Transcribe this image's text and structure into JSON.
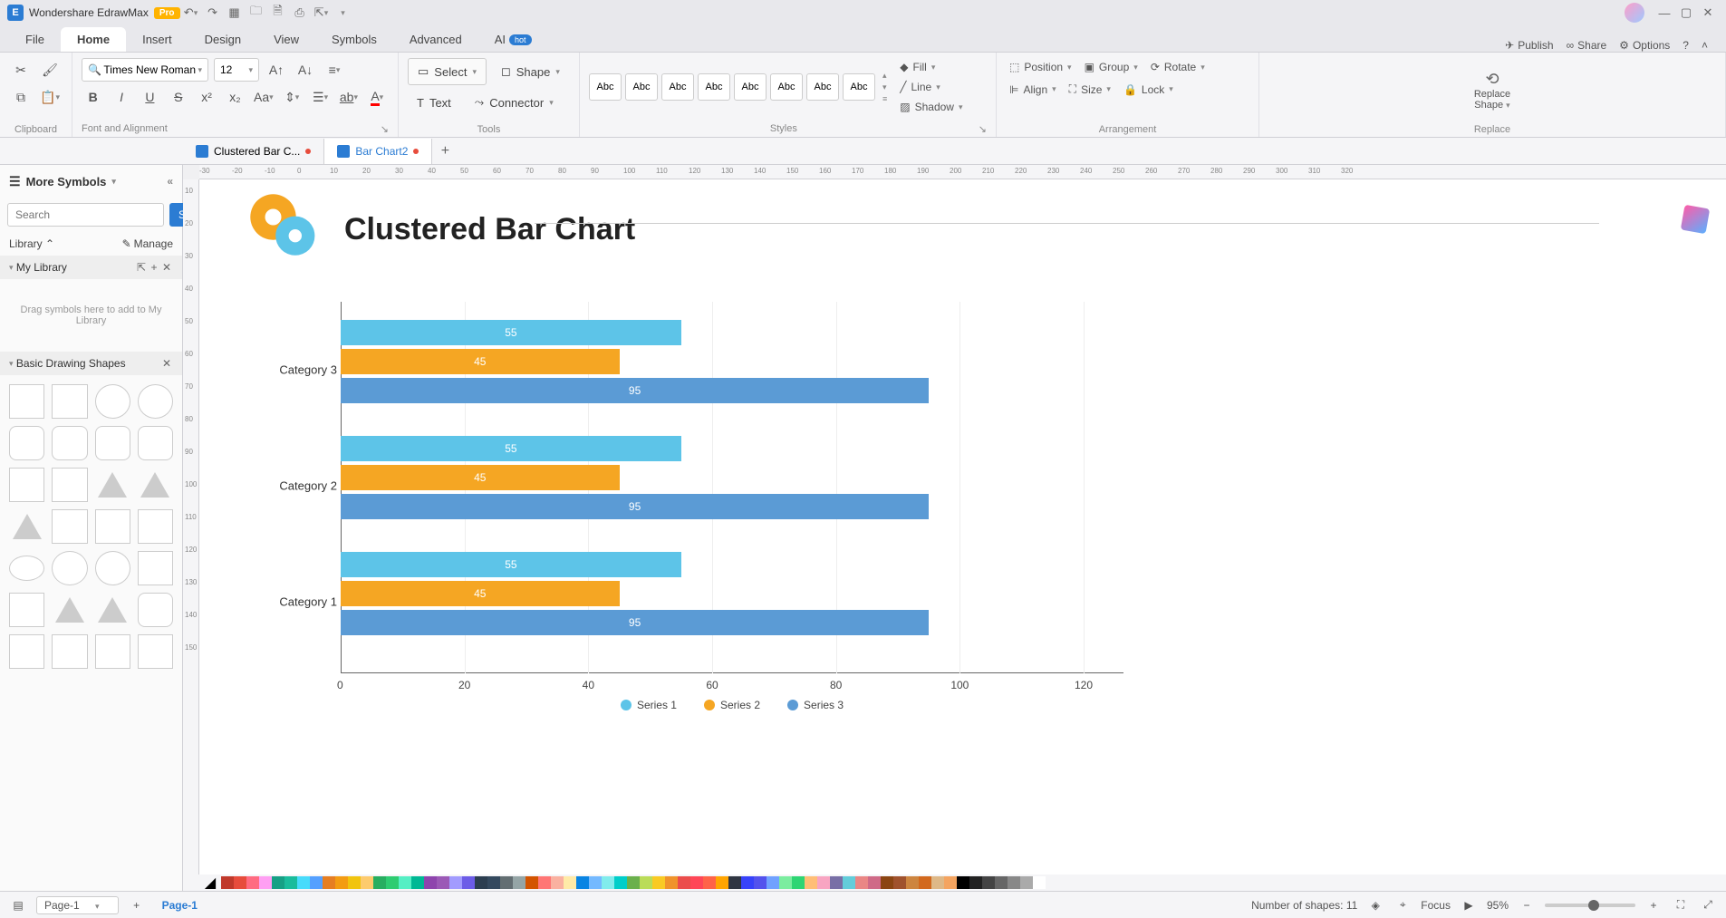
{
  "app": {
    "title": "Wondershare EdrawMax",
    "pro": "Pro"
  },
  "menu": {
    "items": [
      "File",
      "Home",
      "Insert",
      "Design",
      "View",
      "Symbols",
      "Advanced",
      "AI"
    ],
    "active": "Home",
    "hot": "hot",
    "right": {
      "publish": "Publish",
      "share": "Share",
      "options": "Options"
    }
  },
  "ribbon": {
    "clipboard": "Clipboard",
    "font_family": "Times New Roman",
    "font_size": "12",
    "font_alignment": "Font and Alignment",
    "tools": {
      "select": "Select",
      "shape": "Shape",
      "text": "Text",
      "connector": "Connector",
      "label": "Tools"
    },
    "styles": {
      "swatch": "Abc",
      "label": "Styles",
      "fill": "Fill",
      "line": "Line",
      "shadow": "Shadow"
    },
    "arrangement": {
      "position": "Position",
      "group": "Group",
      "rotate": "Rotate",
      "align": "Align",
      "size": "Size",
      "lock": "Lock",
      "label": "Arrangement"
    },
    "replace": {
      "line1": "Replace",
      "line2": "Shape",
      "label": "Replace"
    }
  },
  "tabs": [
    {
      "name": "Clustered Bar C...",
      "active": false,
      "modified": true
    },
    {
      "name": "Bar Chart2",
      "active": true,
      "modified": true
    }
  ],
  "sidebar": {
    "more_symbols": "More Symbols",
    "search_placeholder": "Search",
    "search_btn": "Search",
    "library": "Library",
    "manage": "Manage",
    "my_library": "My Library",
    "drop_hint": "Drag symbols here to add to My Library",
    "basic_shapes": "Basic Drawing Shapes"
  },
  "hruler_ticks": [
    "-30",
    "-20",
    "-10",
    "0",
    "10",
    "20",
    "30",
    "40",
    "50",
    "60",
    "70",
    "80",
    "90",
    "100",
    "110",
    "120",
    "130",
    "140",
    "150",
    "160",
    "170",
    "180",
    "190",
    "200",
    "210",
    "220",
    "230",
    "240",
    "250",
    "260",
    "270",
    "280",
    "290",
    "300",
    "310",
    "320"
  ],
  "vruler_ticks": [
    "10",
    "20",
    "30",
    "40",
    "50",
    "60",
    "70",
    "80",
    "90",
    "100",
    "110",
    "120",
    "130",
    "140",
    "150"
  ],
  "chart_data": {
    "type": "bar",
    "orientation": "horizontal",
    "title": "Clustered Bar Chart",
    "categories": [
      "Category 3",
      "Category 2",
      "Category 1"
    ],
    "series": [
      {
        "name": "Series 1",
        "color": "#5dc4e8",
        "values": [
          55,
          55,
          55
        ]
      },
      {
        "name": "Series 2",
        "color": "#f5a623",
        "values": [
          45,
          45,
          45
        ]
      },
      {
        "name": "Series 3",
        "color": "#5b9bd5",
        "values": [
          95,
          95,
          95
        ]
      }
    ],
    "x_ticks": [
      0,
      20,
      40,
      60,
      80,
      100,
      120
    ],
    "xlim": [
      0,
      120
    ]
  },
  "color_palette": [
    "#c0392b",
    "#e74c3c",
    "#ff6b81",
    "#ff9ff3",
    "#16a085",
    "#1abc9c",
    "#48dbfb",
    "#54a0ff",
    "#e67e22",
    "#f39c12",
    "#f1c40f",
    "#fdcb6e",
    "#27ae60",
    "#2ecc71",
    "#55efc4",
    "#00b894",
    "#8e44ad",
    "#9b59b6",
    "#a29bfe",
    "#6c5ce7",
    "#2c3e50",
    "#34495e",
    "#636e72",
    "#95a5a6",
    "#d35400",
    "#ff7675",
    "#fab1a0",
    "#ffeaa7",
    "#0984e3",
    "#74b9ff",
    "#81ecec",
    "#00cec9",
    "#6ab04c",
    "#badc58",
    "#f9ca24",
    "#f0932b",
    "#eb4d4b",
    "#ff4757",
    "#ff6348",
    "#ffa502",
    "#2f3542",
    "#3742fa",
    "#5352ed",
    "#70a1ff",
    "#7bed9f",
    "#2ed573",
    "#ffbe76",
    "#f8a5c2",
    "#786fa6",
    "#63cdda",
    "#ea8685",
    "#cf6a87",
    "#8B4513",
    "#A0522D",
    "#CD853F",
    "#D2691E",
    "#DEB887",
    "#F4A460",
    "#000000",
    "#222222",
    "#444444",
    "#666666",
    "#888888",
    "#aaaaaa",
    "#ffffff"
  ],
  "status": {
    "page_label": "Page-1",
    "page_tab": "Page-1",
    "shapes": "Number of shapes: 11",
    "focus": "Focus",
    "zoom": "95%"
  }
}
